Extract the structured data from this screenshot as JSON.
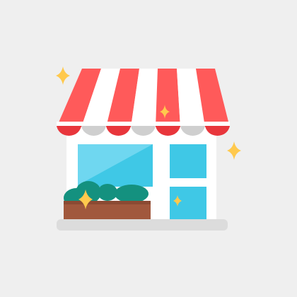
{
  "illustration": {
    "subject": "storefront-icon",
    "colors": {
      "background": "#efefef",
      "awning_red": "#ff5a5a",
      "awning_white": "#ffffff",
      "scallop_red": "#e8363c",
      "scallop_gray": "#cfcfcf",
      "wall": "#ffffff",
      "window_blue": "#3fc8e6",
      "window_light": "#6fd7f0",
      "planter_brown": "#a1583d",
      "planter_top": "#8b4a33",
      "shrub_green": "#14917f",
      "sparkle_gold": "#ffc94d",
      "ground": "#dcdcdc"
    }
  }
}
